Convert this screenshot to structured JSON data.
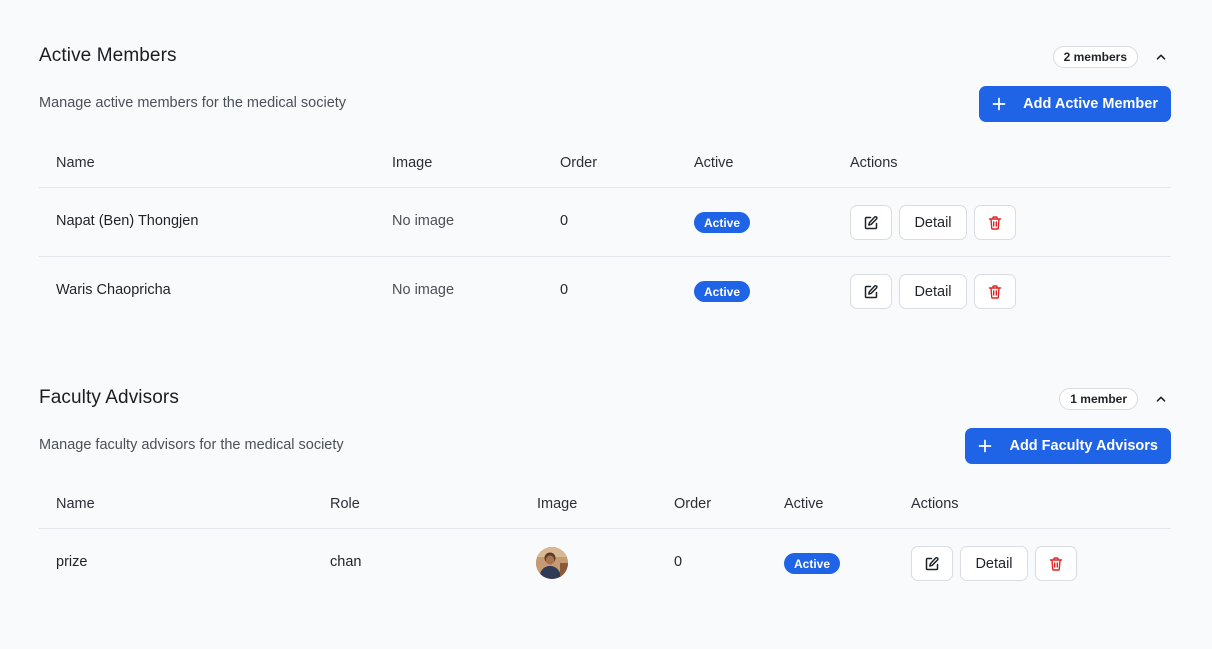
{
  "members": {
    "title": "Active Members",
    "count_badge": "2 members",
    "subtitle": "Manage active members for the medical society",
    "add_button": "Add Active Member",
    "columns": [
      "Name",
      "Image",
      "Order",
      "Active",
      "Actions"
    ],
    "rows": [
      {
        "name": "Napat (Ben) Thongjen",
        "image": "No image",
        "order": "0",
        "active": "Active",
        "detail": "Detail"
      },
      {
        "name": "Waris Chaopricha",
        "image": "No image",
        "order": "0",
        "active": "Active",
        "detail": "Detail"
      }
    ]
  },
  "advisors": {
    "title": "Faculty Advisors",
    "count_badge": "1 member",
    "subtitle": "Manage faculty advisors for the medical society",
    "add_button": "Add Faculty Advisors",
    "columns": [
      "Name",
      "Role",
      "Image",
      "Order",
      "Active",
      "Actions"
    ],
    "rows": [
      {
        "name": "prize",
        "role": "chan",
        "order": "0",
        "active": "Active",
        "detail": "Detail"
      }
    ]
  },
  "icons": {
    "collapse": "chevron-up-icon",
    "add": "plus-icon",
    "edit": "edit-icon",
    "delete": "trash-icon"
  },
  "colors": {
    "accent": "#1f63e6",
    "danger": "#dc2626",
    "background": "#f9fafc"
  }
}
